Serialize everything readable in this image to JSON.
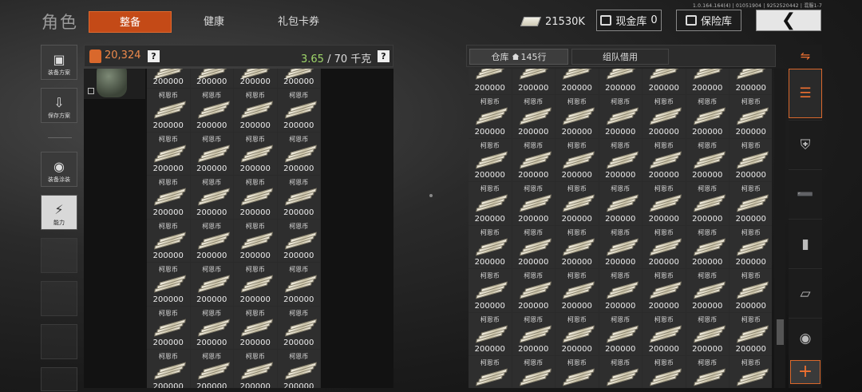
{
  "version": "1.0.164.164(4) | 01051904 | 9252520442 | 混服1-7",
  "page_title": "角色",
  "tabs": [
    {
      "label": "整备",
      "active": true
    },
    {
      "label": "健康",
      "active": false
    },
    {
      "label": "礼包卡券",
      "active": false
    }
  ],
  "top": {
    "koen_balance": "21530K",
    "cash_vault_label": "现金库",
    "cash_vault_count": "0",
    "safe_label": "保险库",
    "back_icon": "chevron-left-icon"
  },
  "sidebar": [
    {
      "label": "装备方案",
      "icon": "vest-icon"
    },
    {
      "label": "保存方案",
      "icon": "download-icon"
    },
    {
      "label": "装备涂装",
      "icon": "spray-icon"
    },
    {
      "label": "能力",
      "icon": "ability-icon",
      "selected": true
    }
  ],
  "equipment": {
    "money": "20,324",
    "weight_current": "3.65",
    "weight_sep": " / ",
    "weight_max": "70",
    "weight_unit": "千克",
    "help": "?"
  },
  "storage": {
    "tab_store": "仓库",
    "rows": "145行",
    "tab_team": "组队借用"
  },
  "item": {
    "label": "柯恩币",
    "amount": "200000"
  },
  "colors": {
    "accent": "#c44a17",
    "money": "#ee8a4c",
    "weight": "#9fd66a"
  },
  "right_sidebar": [
    {
      "icon": "layers-swap-icon"
    },
    {
      "icon": "stack-icon",
      "selected": true
    },
    {
      "icon": "armor-icon"
    },
    {
      "icon": "rifle-icon"
    },
    {
      "icon": "magazine-icon"
    },
    {
      "icon": "bottle-icon"
    },
    {
      "icon": "helmet-icon"
    }
  ],
  "add_button": "+"
}
